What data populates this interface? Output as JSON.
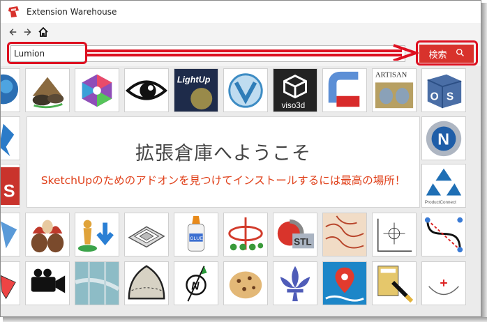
{
  "window": {
    "title": "Extension Warehouse",
    "icon": "extension-warehouse-logo-icon"
  },
  "nav": {
    "back_icon": "back-arrow-icon",
    "forward_icon": "forward-arrow-icon",
    "home_icon": "home-icon"
  },
  "search": {
    "value": "Lumion",
    "button_label": "検索",
    "button_icon": "search-icon"
  },
  "welcome": {
    "title": "拡張倉庫へようこそ",
    "subtitle": "SketchUpのためのアドオンを見つけてインストールするには最高の場所！"
  },
  "tiles": {
    "lightup_label": "LightUp",
    "viso_label": "viso3d",
    "artisan_label": "ARTISAN",
    "productconnect_label": "ProductConnect",
    "s_label": "S",
    "glue_label": "GLUE",
    "stl_label": "STL"
  },
  "colors": {
    "accent_red": "#d8322c",
    "callout_red": "#dd1020",
    "subtitle_orange": "#e0401a"
  }
}
